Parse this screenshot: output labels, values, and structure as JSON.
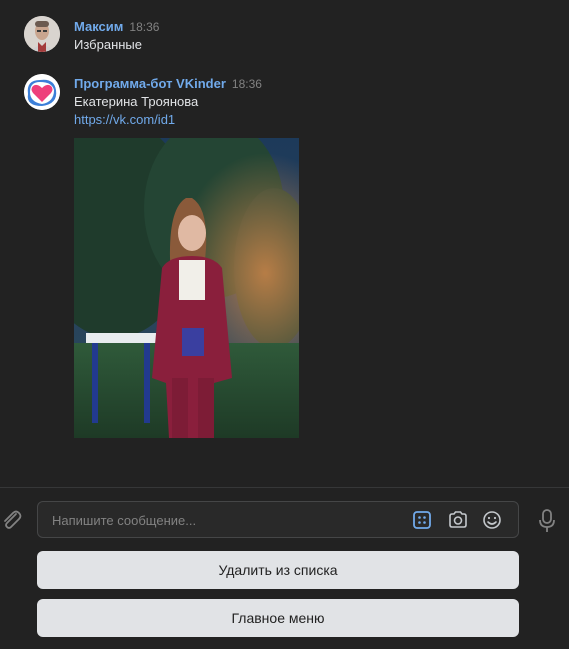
{
  "messages": [
    {
      "author": "Максим",
      "time": "18:36",
      "text": "Избранные"
    },
    {
      "author": "Программа-бот VKinder",
      "time": "18:36",
      "text": "Екатерина Троянова",
      "link": "https://vk.com/id1"
    }
  ],
  "composer": {
    "placeholder": "Напишите сообщение..."
  },
  "keyboard": {
    "buttons": [
      "Удалить из списка",
      "Главное меню"
    ]
  },
  "colors": {
    "background": "#222222",
    "author": "#71aaeb",
    "link": "#71aaeb",
    "button_bg": "#e1e3e6",
    "accent_icon": "#71aaeb"
  },
  "icons": [
    "user-avatar",
    "bot-heart-avatar",
    "attach-icon",
    "keyboard-icon",
    "camera-icon",
    "emoji-icon",
    "mic-icon"
  ]
}
